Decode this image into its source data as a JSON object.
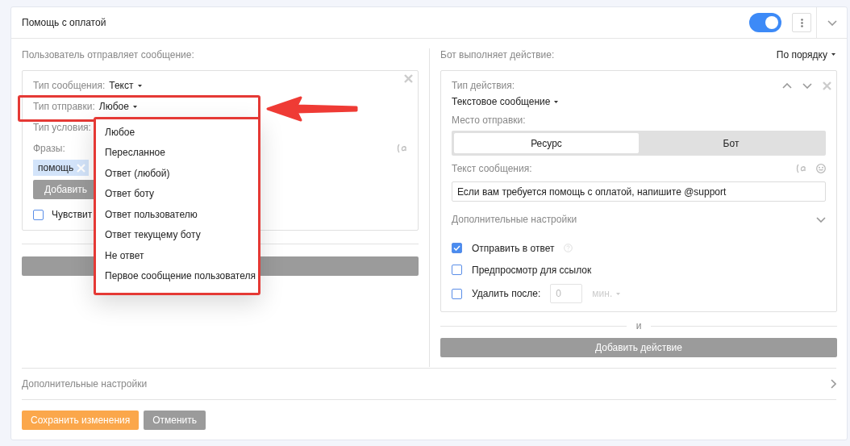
{
  "header": {
    "title": "Помощь с оплатой",
    "enabled": true
  },
  "trigger": {
    "heading": "Пользователь отправляет сообщение:",
    "fields": [
      {
        "label": "Тип сообщения:",
        "value": "Текст",
        "highlighted": false
      },
      {
        "label": "Тип отправки:",
        "value": "Любое",
        "highlighted": true
      },
      {
        "label": "Тип условия:",
        "highlighted": false
      }
    ],
    "phrases_label": "Фразы:",
    "tags": [
      "помощь"
    ],
    "add_button": "Добавить",
    "checkbox": {
      "label": "Чувствит",
      "checked": false
    },
    "dropdown": [
      {
        "label": "Любое",
        "selected": false
      },
      {
        "label": "Пересланное",
        "selected": false
      },
      {
        "label": "Ответ (любой)",
        "selected": false
      },
      {
        "label": "Ответ боту",
        "selected": false
      },
      {
        "label": "Ответ пользователю",
        "selected": false
      },
      {
        "label": "Ответ текущему боту",
        "selected": false
      },
      {
        "label": "Не ответ",
        "selected": false
      },
      {
        "label": "Первое сообщение пользователя",
        "selected": false
      }
    ]
  },
  "actions": {
    "heading": "Бот выполняет действие:",
    "order": "По порядку",
    "card": {
      "type_label": "Тип действия:",
      "type_value": "Текстовое сообщение",
      "place_label": "Место отправки:",
      "places": [
        {
          "label": "Ресурс",
          "selected": true
        },
        {
          "label": "Бот",
          "selected": false
        }
      ],
      "text_label": "Текст сообщения:",
      "text_value": "Если вам требуется помощь с оплатой, напишите @support",
      "settings_label": "Дополнительные настройки",
      "options": [
        {
          "label": "Отправить в ответ",
          "checked": true,
          "help": true
        },
        {
          "label": "Предпросмотр для ссылок",
          "checked": false,
          "help": false
        },
        {
          "label": "Удалить после:",
          "checked": false,
          "help": false,
          "input_value": "0",
          "unit": "мин."
        }
      ]
    },
    "separator": "и",
    "add_button": "Добавить действие"
  },
  "extra_settings": "Дополнительные настройки",
  "buttons": [
    {
      "label": "Сохранить изменения",
      "kind": "primary"
    },
    {
      "label": "Отменить",
      "kind": "secondary"
    }
  ]
}
